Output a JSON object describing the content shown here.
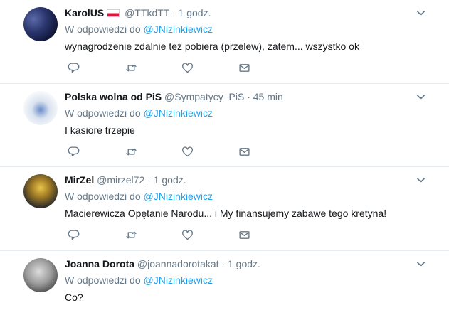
{
  "tweets": [
    {
      "fullname": "KarolUS",
      "has_flag": true,
      "handle": "@TTkdTT",
      "separator": "·",
      "time": "1 godz.",
      "reply_prefix": "W odpowiedzi do",
      "reply_mention": "@JNizinkiewicz",
      "text": "wynagrodzenie zdalnie też pobiera (przelew), zatem... wszystko ok"
    },
    {
      "fullname": "Polska wolna od PiS",
      "handle": "@Sympatycy_PiS",
      "separator": "·",
      "time": "45 min",
      "reply_prefix": "W odpowiedzi do",
      "reply_mention": "@JNizinkiewicz",
      "text": "I kasiore trzepie"
    },
    {
      "fullname": "MirZel",
      "handle": "@mirzel72",
      "separator": "·",
      "time": "1 godz.",
      "reply_prefix": "W odpowiedzi do",
      "reply_mention": "@JNizinkiewicz",
      "text": "Macierewicza Opętanie Narodu... i My finansujemy zabawe tego kretyna!"
    },
    {
      "fullname": "Joanna Dorota",
      "handle": "@joannadorotakat",
      "separator": "·",
      "time": "1 godz.",
      "reply_prefix": "W odpowiedzi do",
      "reply_mention": "@JNizinkiewicz",
      "text": "Co?"
    }
  ],
  "icons": {
    "reply": "reply-icon",
    "retweet": "retweet-icon",
    "like": "heart-icon",
    "dm": "envelope-icon",
    "menu": "chevron-down-icon"
  },
  "colors": {
    "mention": "#1da1f2",
    "secondary_text": "#657786",
    "icon": "#657786",
    "divider": "#e6ecf0"
  }
}
